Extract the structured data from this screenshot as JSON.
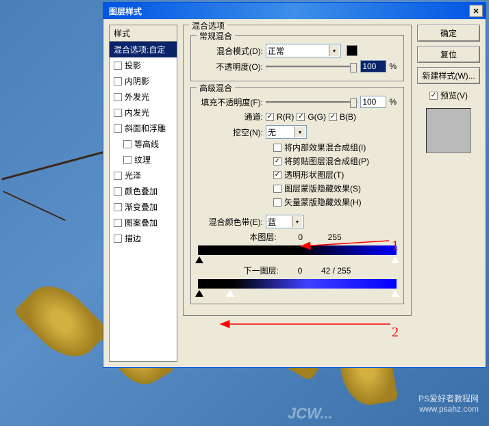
{
  "titlebar": {
    "title": "图层样式"
  },
  "styles": {
    "header": "样式",
    "items": [
      {
        "label": "混合选项:自定",
        "selected": true,
        "checkbox": false
      },
      {
        "label": "投影",
        "checkbox": true
      },
      {
        "label": "内阴影",
        "checkbox": true
      },
      {
        "label": "外发光",
        "checkbox": true
      },
      {
        "label": "内发光",
        "checkbox": true
      },
      {
        "label": "斜面和浮雕",
        "checkbox": true
      },
      {
        "label": "等高线",
        "checkbox": true,
        "indented": true
      },
      {
        "label": "纹理",
        "checkbox": true,
        "indented": true
      },
      {
        "label": "光泽",
        "checkbox": true
      },
      {
        "label": "颜色叠加",
        "checkbox": true
      },
      {
        "label": "渐变叠加",
        "checkbox": true
      },
      {
        "label": "图案叠加",
        "checkbox": true
      },
      {
        "label": "描边",
        "checkbox": true
      }
    ]
  },
  "blending": {
    "main_legend": "混合选项",
    "general_legend": "常规混合",
    "mode_label": "混合模式(D):",
    "mode_value": "正常",
    "opacity_label": "不透明度(O):",
    "opacity_value": "100",
    "opacity_unit": "%",
    "advanced_legend": "高级混合",
    "fill_label": "填充不透明度(F):",
    "fill_value": "100",
    "fill_unit": "%",
    "channels_label": "通道:",
    "channel_r": "R(R)",
    "channel_g": "G(G)",
    "channel_b": "B(B)",
    "knockout_label": "挖空(N):",
    "knockout_value": "无",
    "adv_checks": [
      {
        "label": "将内部效果混合成组(I)",
        "checked": false
      },
      {
        "label": "将剪贴图层混合成组(P)",
        "checked": true
      },
      {
        "label": "透明形状图层(T)",
        "checked": true
      },
      {
        "label": "图层蒙版隐藏效果(S)",
        "checked": false
      },
      {
        "label": "矢量蒙版隐藏效果(H)",
        "checked": false
      }
    ],
    "blendif_label": "混合颜色带(E):",
    "blendif_value": "蓝",
    "this_layer_label": "本图层:",
    "this_layer_low": "0",
    "this_layer_high": "255",
    "under_layer_label": "下一图层:",
    "under_layer_low": "0",
    "under_layer_mid": "42",
    "under_layer_sep": "/",
    "under_layer_high": "255"
  },
  "buttons": {
    "ok": "确定",
    "cancel": "复位",
    "new_style": "新建样式(W)...",
    "preview": "预览(V)"
  },
  "annotations": {
    "one": "1",
    "two": "2"
  },
  "watermark": {
    "line1": "PS爱好者教程网",
    "line2": "www.psahz.com",
    "jcw": "JCW..."
  }
}
